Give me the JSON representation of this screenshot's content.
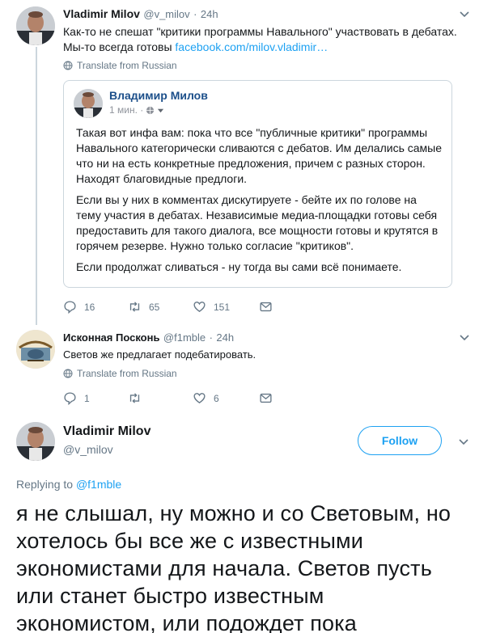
{
  "tweet1": {
    "name": "Vladimir Milov",
    "handle": "@v_milov",
    "sep": "·",
    "time": "24h",
    "text_line1": "Как-то не спешат \"критики программы Навального\" участвовать в дебатах.",
    "text_line2_prefix": "Мы-то всегда готовы ",
    "link": "facebook.com/milov.vladimir…",
    "translate": "Translate from Russian",
    "quote": {
      "name": "Владимир Милов",
      "time": "1 мин. ·",
      "p1": "Такая вот инфа вам: пока что все \"публичные критики\" программы Навального категорически сливаются с дебатов. Им делались самые что ни на есть конкретные предложения, причем с разных сторон. Находят благовидные предлоги.",
      "p2": "Если вы у них в комментах дискутируете - бейте их по голове на тему участия в дебатах. Независимые медиа-площадки готовы себя предоставить для такого диалога, все мощности готовы и крутятся в горячем резерве. Нужно только согласие \"критиков\".",
      "p3": "Если продолжат сливаться - ну тогда вы сами всё понимаете."
    },
    "replies": "16",
    "retweets": "65",
    "likes": "151"
  },
  "tweet2": {
    "name": "Исконная Посконь",
    "handle": "@f1mble",
    "sep": "·",
    "time": "24h",
    "text": "Светов же предлагает подебатировать.",
    "translate": "Translate from Russian",
    "replies": "1",
    "retweets": "",
    "likes": "6"
  },
  "main_tweet": {
    "name": "Vladimir Milov",
    "handle": "@v_milov",
    "follow_label": "Follow",
    "replying_prefix": "Replying to ",
    "replying_to": "@f1mble",
    "text": "я не слышал, ну можно и со Световым, но хотелось бы все же с известными экономистами для начала. Светов пусть или станет быстро известным экономистом, или подождет пока"
  },
  "colors": {
    "accent": "#1da1f2",
    "secondary_text": "#657786",
    "border": "#ccd6dd",
    "quote_name": "#1c4f8a"
  }
}
